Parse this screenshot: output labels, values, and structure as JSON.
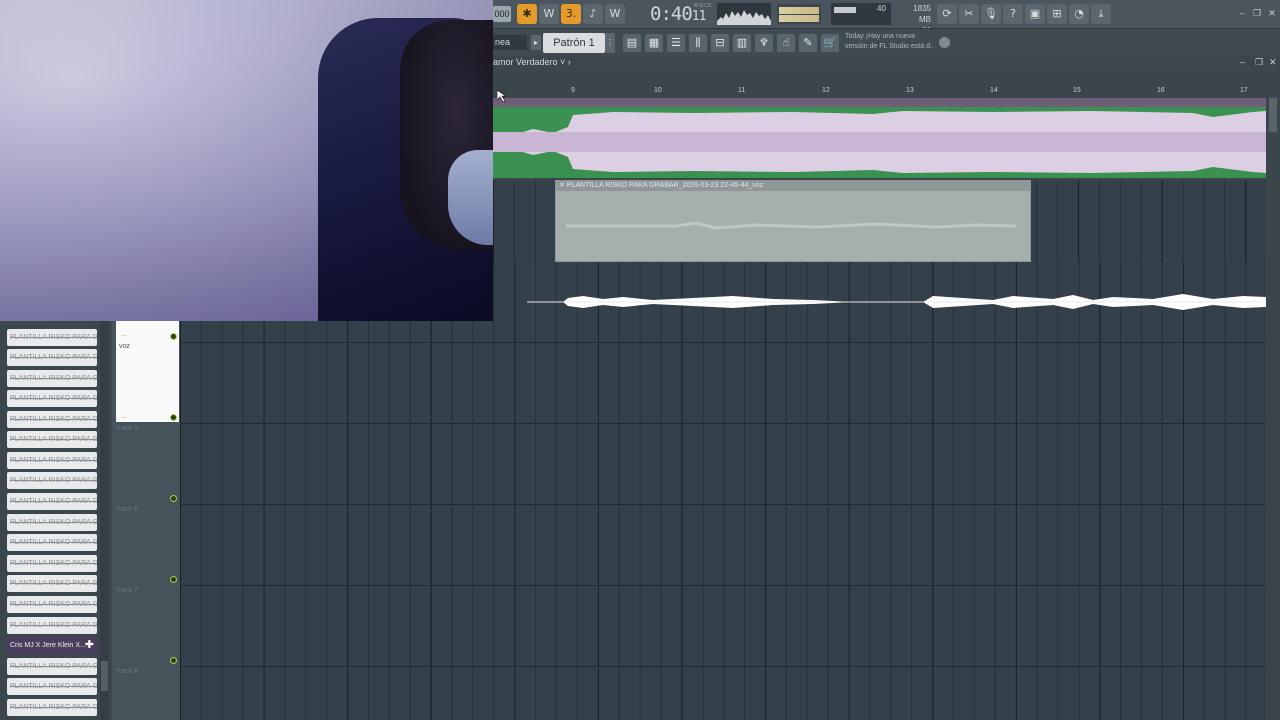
{
  "toolbar": {
    "tempo_display": "000",
    "time": "0:40",
    "time_small": "11",
    "time_label": "M:S:CS",
    "cpu_value": "40",
    "mem_value": "1835 MB",
    "poly_value": "61",
    "pattern_left": "nea",
    "pattern_name": "Patrón 1",
    "news_line1": "Today ¡Hay una nueva",
    "news_line2": "versión de FL Studio está d..",
    "btn_record": "✱",
    "btn_1": "W",
    "btn_2": "3.",
    "btn_3": "♪",
    "btn_4": "W"
  },
  "playlist": {
    "title": "amor Verdadero",
    "ruler_ticks": [
      "9",
      "10",
      "11",
      "12",
      "13",
      "14",
      "15",
      "16",
      "17"
    ]
  },
  "clips": {
    "gray_clip_name": "PLANTILLA RISKO PARA GRABAR_2026-03-23 22-45-44_voz"
  },
  "browser": {
    "items": [
      "PLANTILLA RISKO PARA GR...",
      "PLANTILLA RISKO PARA GR...",
      "PLANTILLA RISKO PARA GR...",
      "PLANTILLA RISKO PARA GR...",
      "PLANTILLA RISKO PARA GR...",
      "PLANTILLA RISKO PARA GR...",
      "PLANTILLA RISKO PARA GR...",
      "PLANTILLA RISKO PARA GR...",
      "PLANTILLA RISKO PARA GR...",
      "PLANTILLA RISKO PARA GR...",
      "PLANTILLA RISKO PARA GR...",
      "PLANTILLA RISKO PARA GR...",
      "PLANTILLA RISKO PARA GR...",
      "PLANTILLA RISKO PARA GR...",
      "PLANTILLA RISKO PARA GR...",
      "Cris MJ X Jere Klein X...",
      "PLANTILLA RISKO PARA GR...",
      "PLANTILLA RISKO PARA GR...",
      "PLANTILLA RISKO PARA GR..."
    ],
    "selected_index": 15
  },
  "tracks": {
    "track4_label": "voz",
    "track5": "Track 5",
    "track6": "Track 6",
    "track7": "Track 7",
    "track8": "Track 8",
    "dots": "..."
  }
}
